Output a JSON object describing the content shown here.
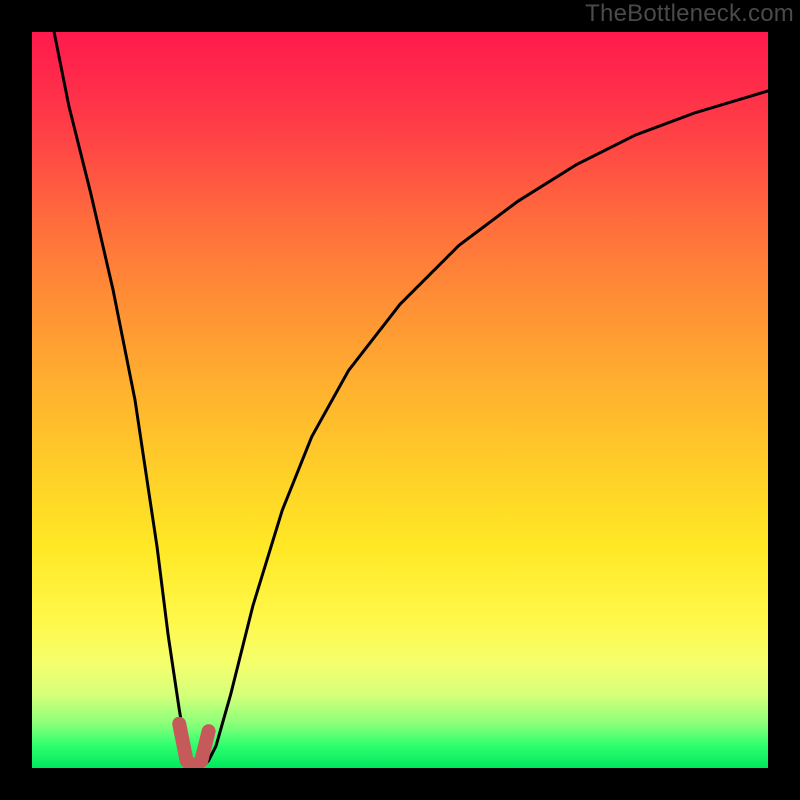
{
  "watermark": "TheBottleneck.com",
  "colors": {
    "page_bg": "#000000",
    "curve_stroke": "#000000",
    "highlight_stroke": "#c65a5a"
  },
  "chart_data": {
    "type": "line",
    "title": "",
    "xlabel": "",
    "ylabel": "",
    "xlim": [
      0,
      100
    ],
    "ylim": [
      0,
      100
    ],
    "grid": false,
    "legend": false,
    "series": [
      {
        "name": "bottleneck-curve",
        "x": [
          3,
          5,
          8,
          11,
          14,
          17,
          18.5,
          20,
          21,
          22,
          23,
          24,
          25,
          27,
          30,
          34,
          38,
          43,
          50,
          58,
          66,
          74,
          82,
          90,
          100
        ],
        "y": [
          100,
          90,
          78,
          65,
          50,
          30,
          18,
          8,
          2,
          0,
          0,
          1,
          3,
          10,
          22,
          35,
          45,
          54,
          63,
          71,
          77,
          82,
          86,
          89,
          92
        ]
      }
    ],
    "highlight_region": {
      "name": "optimal-range",
      "x": [
        20,
        21,
        22,
        23,
        24
      ],
      "y": [
        6,
        1,
        0,
        1,
        5
      ]
    },
    "background_gradient_meaning": "red (top) = high bottleneck, green (bottom) = low bottleneck"
  }
}
